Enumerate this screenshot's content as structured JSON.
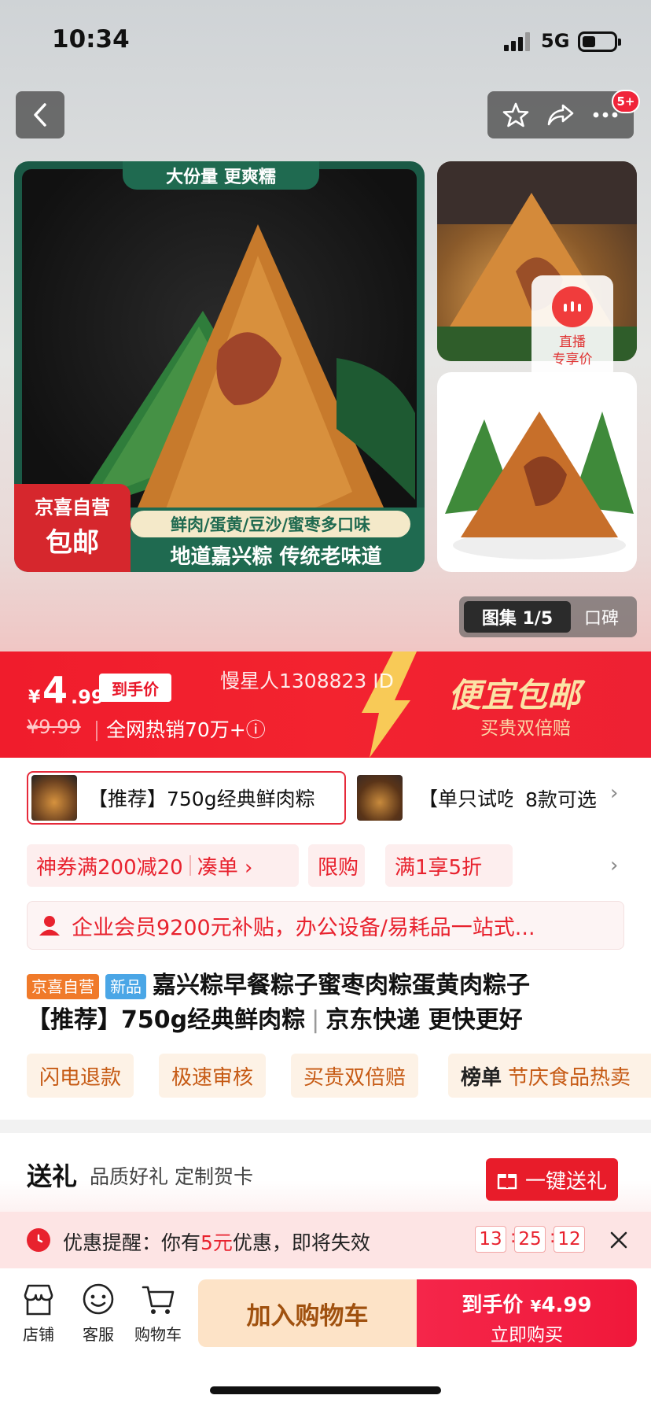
{
  "status_bar": {
    "time": "10:34",
    "network": "5G"
  },
  "nav": {
    "badge": "5+"
  },
  "gallery": {
    "main": {
      "top_banner": "大份量 更爽糯",
      "feature_1": "鲜肉/蛋黄/豆沙/蜜枣多口味",
      "feature_2": "地道嘉兴粽 传统老味道",
      "seal_line1": "京喜自营",
      "seal_line2": "包邮"
    },
    "live": {
      "line1": "直播",
      "line2": "专享价"
    },
    "tabs": {
      "active": "图集 1/5",
      "inactive": "口碑"
    }
  },
  "price": {
    "currency": "¥",
    "integer": "4",
    "decimal": ".99",
    "tag": "到手价",
    "original": "¥9.99",
    "sales": "全网热销70万+ⓘ",
    "watermark": "慢星人1308823 ID",
    "promo_title": "便宜包邮",
    "promo_sub": "买贵双倍赔"
  },
  "variants": {
    "selected": "【推荐】750g经典鲜肉粽",
    "second": "【单只试吃】",
    "more": "8款可选"
  },
  "coupons": [
    {
      "label": "神券满200减20",
      "action": "凑单 ›"
    },
    {
      "label": "限购"
    },
    {
      "label": "满1享5折"
    }
  ],
  "member": {
    "text": "企业会员9200元补贴，办公设备/易耗品一站式..."
  },
  "product": {
    "tag_self": "京喜自营",
    "tag_new": "新品",
    "title_1": "嘉兴粽早餐粽子蜜枣肉粽蛋黄肉粽子",
    "title_2": "【推荐】750g经典鲜肉粽",
    "title_3": "京东快递 更快更好"
  },
  "services": [
    {
      "label": "闪电退款"
    },
    {
      "label": "极速审核"
    },
    {
      "label": "买贵双倍赔"
    },
    {
      "prefix": "榜单",
      "label": "节庆食品热卖"
    }
  ],
  "gift": {
    "title": "送礼",
    "subtitle": "品质好礼 定制贺卡",
    "button": "一键送礼"
  },
  "reminder": {
    "prefix": "优惠提醒：你有",
    "amount": "5元",
    "suffix": "优惠，即将失效",
    "hh": "13",
    "mm": "25",
    "ss": "12"
  },
  "bottom": {
    "store": "店铺",
    "service": "客服",
    "cart": "购物车",
    "add_cart": "加入购物车",
    "buy_line1": "到手价",
    "buy_price_cur": "¥",
    "buy_price": "4.99",
    "buy_line2": "立即购买"
  },
  "colors": {
    "accent": "#e8222e",
    "banner": "#f01c2c",
    "cart_btn": "#fde3c7"
  }
}
